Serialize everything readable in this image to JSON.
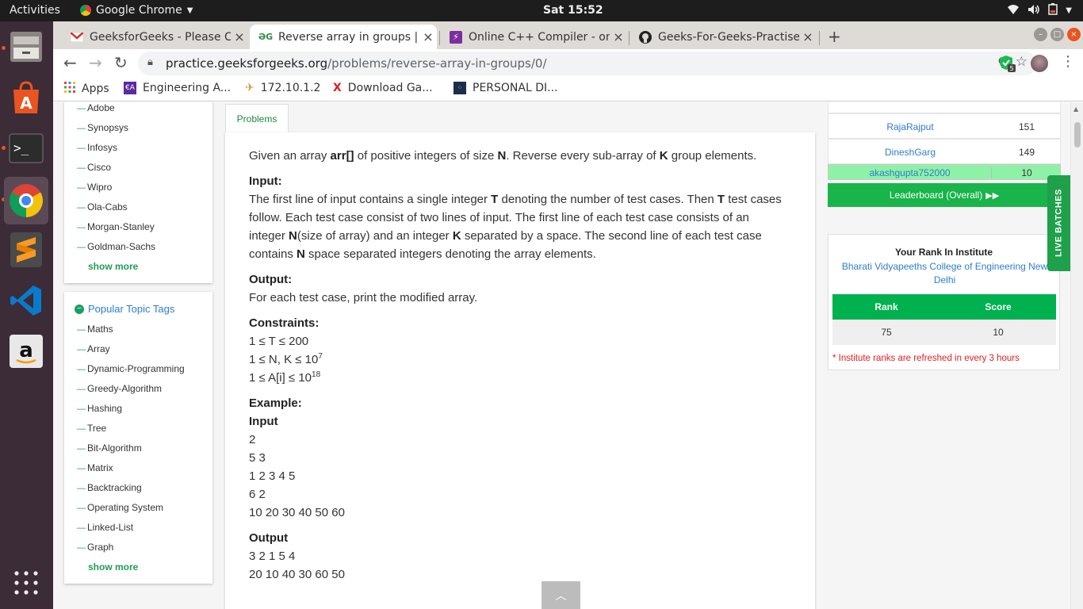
{
  "topbar": {
    "activities": "Activities",
    "app_name": "Google Chrome",
    "clock": "Sat 15:52"
  },
  "tabs": [
    {
      "title": "GeeksforGeeks - Please Co",
      "favicon": "gmail-icon"
    },
    {
      "title": "Reverse array in groups | P",
      "favicon": "gfg-icon"
    },
    {
      "title": "Online C++ Compiler - onli",
      "favicon": "bolt-icon"
    },
    {
      "title": "Geeks-For-Geeks-Practise",
      "favicon": "github-icon"
    }
  ],
  "toolbar": {
    "url_host": "practice.geeksforgeeks.org",
    "url_path": "/problems/reverse-array-in-groups/0/",
    "ext_badge": "5"
  },
  "bookmarks": [
    {
      "label": "Apps"
    },
    {
      "label": "Engineering A..."
    },
    {
      "label": "172.10.1.2"
    },
    {
      "label": "Download Ga..."
    },
    {
      "label": "PERSONAL DI..."
    }
  ],
  "companies": {
    "items": [
      "Adobe",
      "Synopsys",
      "Infosys",
      "Cisco",
      "Wipro",
      "Ola-Cabs",
      "Morgan-Stanley",
      "Goldman-Sachs"
    ],
    "show_more": "show more"
  },
  "topics": {
    "title": "Popular Topic Tags",
    "items": [
      "Maths",
      "Array",
      "Dynamic-Programming",
      "Greedy-Algorithm",
      "Hashing",
      "Tree",
      "Bit-Algorithm",
      "Matrix",
      "Backtracking",
      "Operating System",
      "Linked-List",
      "Graph"
    ],
    "show_more": "show more"
  },
  "problem": {
    "tab": "Problems",
    "intro_1": "Given an array ",
    "arr": "arr[]",
    "intro_2": " of positive integers of size ",
    "n": "N",
    "intro_3": ". Reverse every sub-array of ",
    "k": "K",
    "intro_4": " group elements.",
    "input_h": "Input:",
    "input_1": "The first line of input contains a single integer ",
    "t": "T",
    "input_2": " denoting the number of test cases. Then ",
    "input_3": " test cases follow. Each test case consist of two lines of input. The first line of each test case consists of an integer ",
    "input_4": "(size of array) and an integer ",
    "input_5": " separated by a space. The second line of each test case contains ",
    "input_6": " space separated integers denoting the array elements.",
    "output_h": "Output:",
    "output_text": "For each test case, print the modified array.",
    "constraints_h": "Constraints:",
    "c1": "1 ≤ T ≤ 200",
    "c2": "1 ≤ N, K ≤ 10",
    "c2_exp": "7",
    "c3": "1 ≤ A[i] ≤ 10",
    "c3_exp": "18",
    "example_h": "Example:",
    "ex_input_h": "Input",
    "ex_input": [
      "2",
      "5 3",
      "1 2 3 4 5",
      "6 2",
      "10 20 30 40 50 60"
    ],
    "ex_output_h": "Output",
    "ex_output": [
      "3 2 1 5 4",
      "20 10 40 30 60 50"
    ]
  },
  "leaderboard": {
    "rows": [
      {
        "name": "RajaRajput",
        "score": "151"
      },
      {
        "name": "DineshGarg",
        "score": "149"
      }
    ],
    "me": {
      "name": "akashgupta752000",
      "score": "10"
    },
    "button": "Leaderboard (Overall)"
  },
  "rank": {
    "title": "Your Rank In Institute",
    "institute": "Bharati Vidyapeeths College of Engineering New Delhi",
    "col_rank": "Rank",
    "col_score": "Score",
    "rank": "75",
    "score": "10",
    "note": "* Institute ranks are refreshed in every 3 hours"
  },
  "live_batches": "LIVE BATCHES",
  "colors": {
    "gfg_green": "#1f9d55",
    "link_blue": "#2e7dd1",
    "ubuntu_orange": "#e95420"
  }
}
